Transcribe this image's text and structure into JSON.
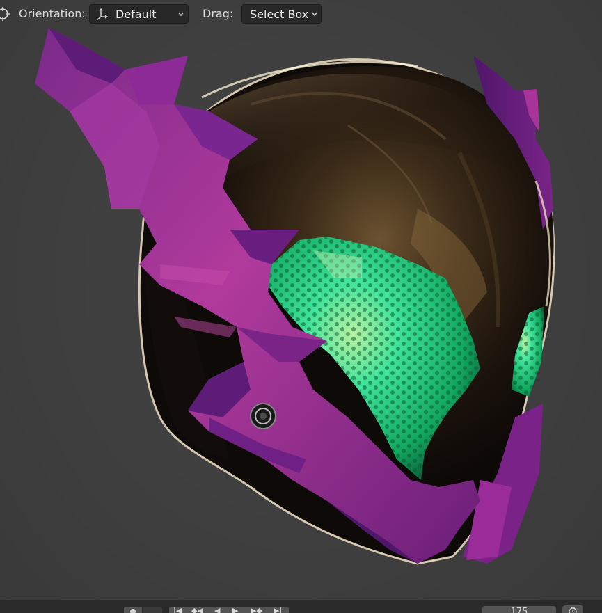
{
  "header": {
    "orientation_label": "Orientation:",
    "orientation_value": "Default",
    "drag_label": "Drag:",
    "drag_value": "Select Box"
  },
  "viewport": {
    "subject": "purple spiked helmet with mirrored visor and green honeycomb eye panels",
    "colors": {
      "background": "#3d3d3d",
      "shell_purple": "#9b2c9a",
      "shell_dark_purple": "#5d1a6c",
      "visor_dark": "#1a120c",
      "visor_gold": "#7a5a2e",
      "eye_green": "#22e08a"
    }
  },
  "timeline": {
    "current_frame": "175"
  },
  "icons": {
    "transform": "transform-pivot-icon",
    "orientation": "orientation-axes-icon",
    "clock": "clock-icon"
  }
}
